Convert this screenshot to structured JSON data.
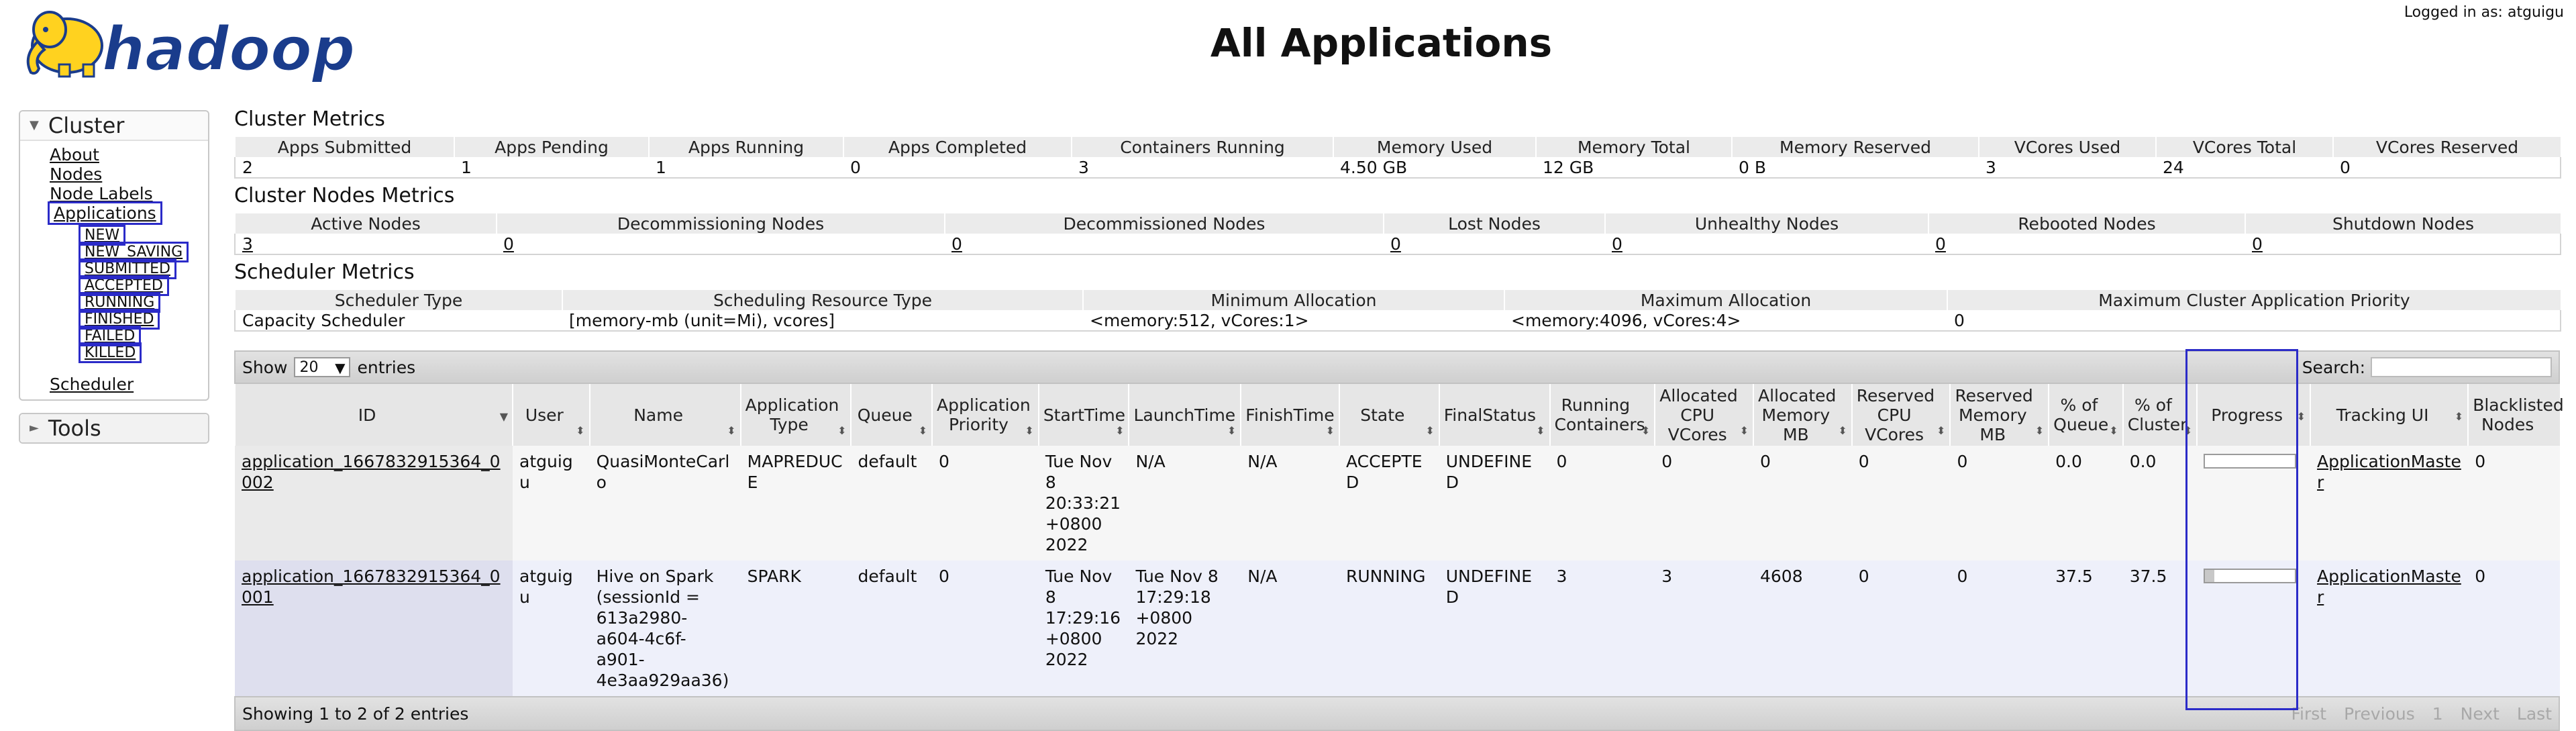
{
  "header": {
    "logo_text": "hadoop",
    "title": "All Applications",
    "logged_in": "Logged in as: atguigu"
  },
  "sidebar": {
    "cluster_label": "Cluster",
    "items": [
      "About",
      "Nodes",
      "Node Labels",
      "Applications"
    ],
    "states": [
      "NEW",
      "NEW_SAVING",
      "SUBMITTED",
      "ACCEPTED",
      "RUNNING",
      "FINISHED",
      "FAILED",
      "KILLED"
    ],
    "scheduler": "Scheduler",
    "tools_label": "Tools"
  },
  "cluster_metrics": {
    "title": "Cluster Metrics",
    "headers": [
      "Apps Submitted",
      "Apps Pending",
      "Apps Running",
      "Apps Completed",
      "Containers Running",
      "Memory Used",
      "Memory Total",
      "Memory Reserved",
      "VCores Used",
      "VCores Total",
      "VCores Reserved"
    ],
    "values": [
      "2",
      "1",
      "1",
      "0",
      "3",
      "4.50 GB",
      "12 GB",
      "0 B",
      "3",
      "24",
      "0"
    ]
  },
  "nodes_metrics": {
    "title": "Cluster Nodes Metrics",
    "headers": [
      "Active Nodes",
      "Decommissioning Nodes",
      "Decommissioned Nodes",
      "Lost Nodes",
      "Unhealthy Nodes",
      "Rebooted Nodes",
      "Shutdown Nodes"
    ],
    "values": [
      "3",
      "0",
      "0",
      "0",
      "0",
      "0",
      "0"
    ]
  },
  "scheduler_metrics": {
    "title": "Scheduler Metrics",
    "headers": [
      "Scheduler Type",
      "Scheduling Resource Type",
      "Minimum Allocation",
      "Maximum Allocation",
      "Maximum Cluster Application Priority"
    ],
    "values": [
      "Capacity Scheduler",
      "[memory-mb (unit=Mi), vcores]",
      "<memory:512, vCores:1>",
      "<memory:4096, vCores:4>",
      "0"
    ]
  },
  "table_controls": {
    "show": "Show",
    "page_length": "20",
    "entries": "entries",
    "search_label": "Search:",
    "search_value": "",
    "info": "Showing 1 to 2 of 2 entries",
    "pager": [
      "First",
      "Previous",
      "1",
      "Next",
      "Last"
    ]
  },
  "apps_table": {
    "headers": [
      "ID",
      "User",
      "Name",
      "Application Type",
      "Queue",
      "Application Priority",
      "StartTime",
      "LaunchTime",
      "FinishTime",
      "State",
      "FinalStatus",
      "Running Containers",
      "Allocated CPU VCores",
      "Allocated Memory MB",
      "Reserved CPU VCores",
      "Reserved Memory MB",
      "% of Queue",
      "% of Cluster",
      "Progress",
      "Tracking UI",
      "Blacklisted Nodes"
    ],
    "rows": [
      {
        "id": "application_1667832915364_0002",
        "user": "atguigu",
        "name": "QuasiMonteCarlo",
        "type": "MAPREDUCE",
        "queue": "default",
        "priority": "0",
        "start": "Tue Nov 8 20:33:21 +0800 2022",
        "launch": "N/A",
        "finish": "N/A",
        "state": "ACCEPTED",
        "final_status": "UNDEFINED",
        "running_containers": "0",
        "alloc_vcores": "0",
        "alloc_mem": "0",
        "res_vcores": "0",
        "res_mem": "0",
        "pct_queue": "0.0",
        "pct_cluster": "0.0",
        "progress": 0,
        "tracking": "ApplicationMaster",
        "blacklisted": "0"
      },
      {
        "id": "application_1667832915364_0001",
        "user": "atguigu",
        "name": "Hive on Spark (sessionId = 613a2980-a604-4c6f-a901-4e3aa929aa36)",
        "type": "SPARK",
        "queue": "default",
        "priority": "0",
        "start": "Tue Nov 8 17:29:16 +0800 2022",
        "launch": "Tue Nov 8 17:29:18 +0800 2022",
        "finish": "N/A",
        "state": "RUNNING",
        "final_status": "UNDEFINED",
        "running_containers": "3",
        "alloc_vcores": "3",
        "alloc_mem": "4608",
        "res_vcores": "0",
        "res_mem": "0",
        "pct_queue": "37.5",
        "pct_cluster": "37.5",
        "progress": 10,
        "tracking": "ApplicationMaster",
        "blacklisted": "0"
      }
    ]
  },
  "colors": {
    "highlight": "#2b2bc8",
    "logo_blue": "#1a3c8c",
    "logo_yellow": "#ffd21f"
  }
}
